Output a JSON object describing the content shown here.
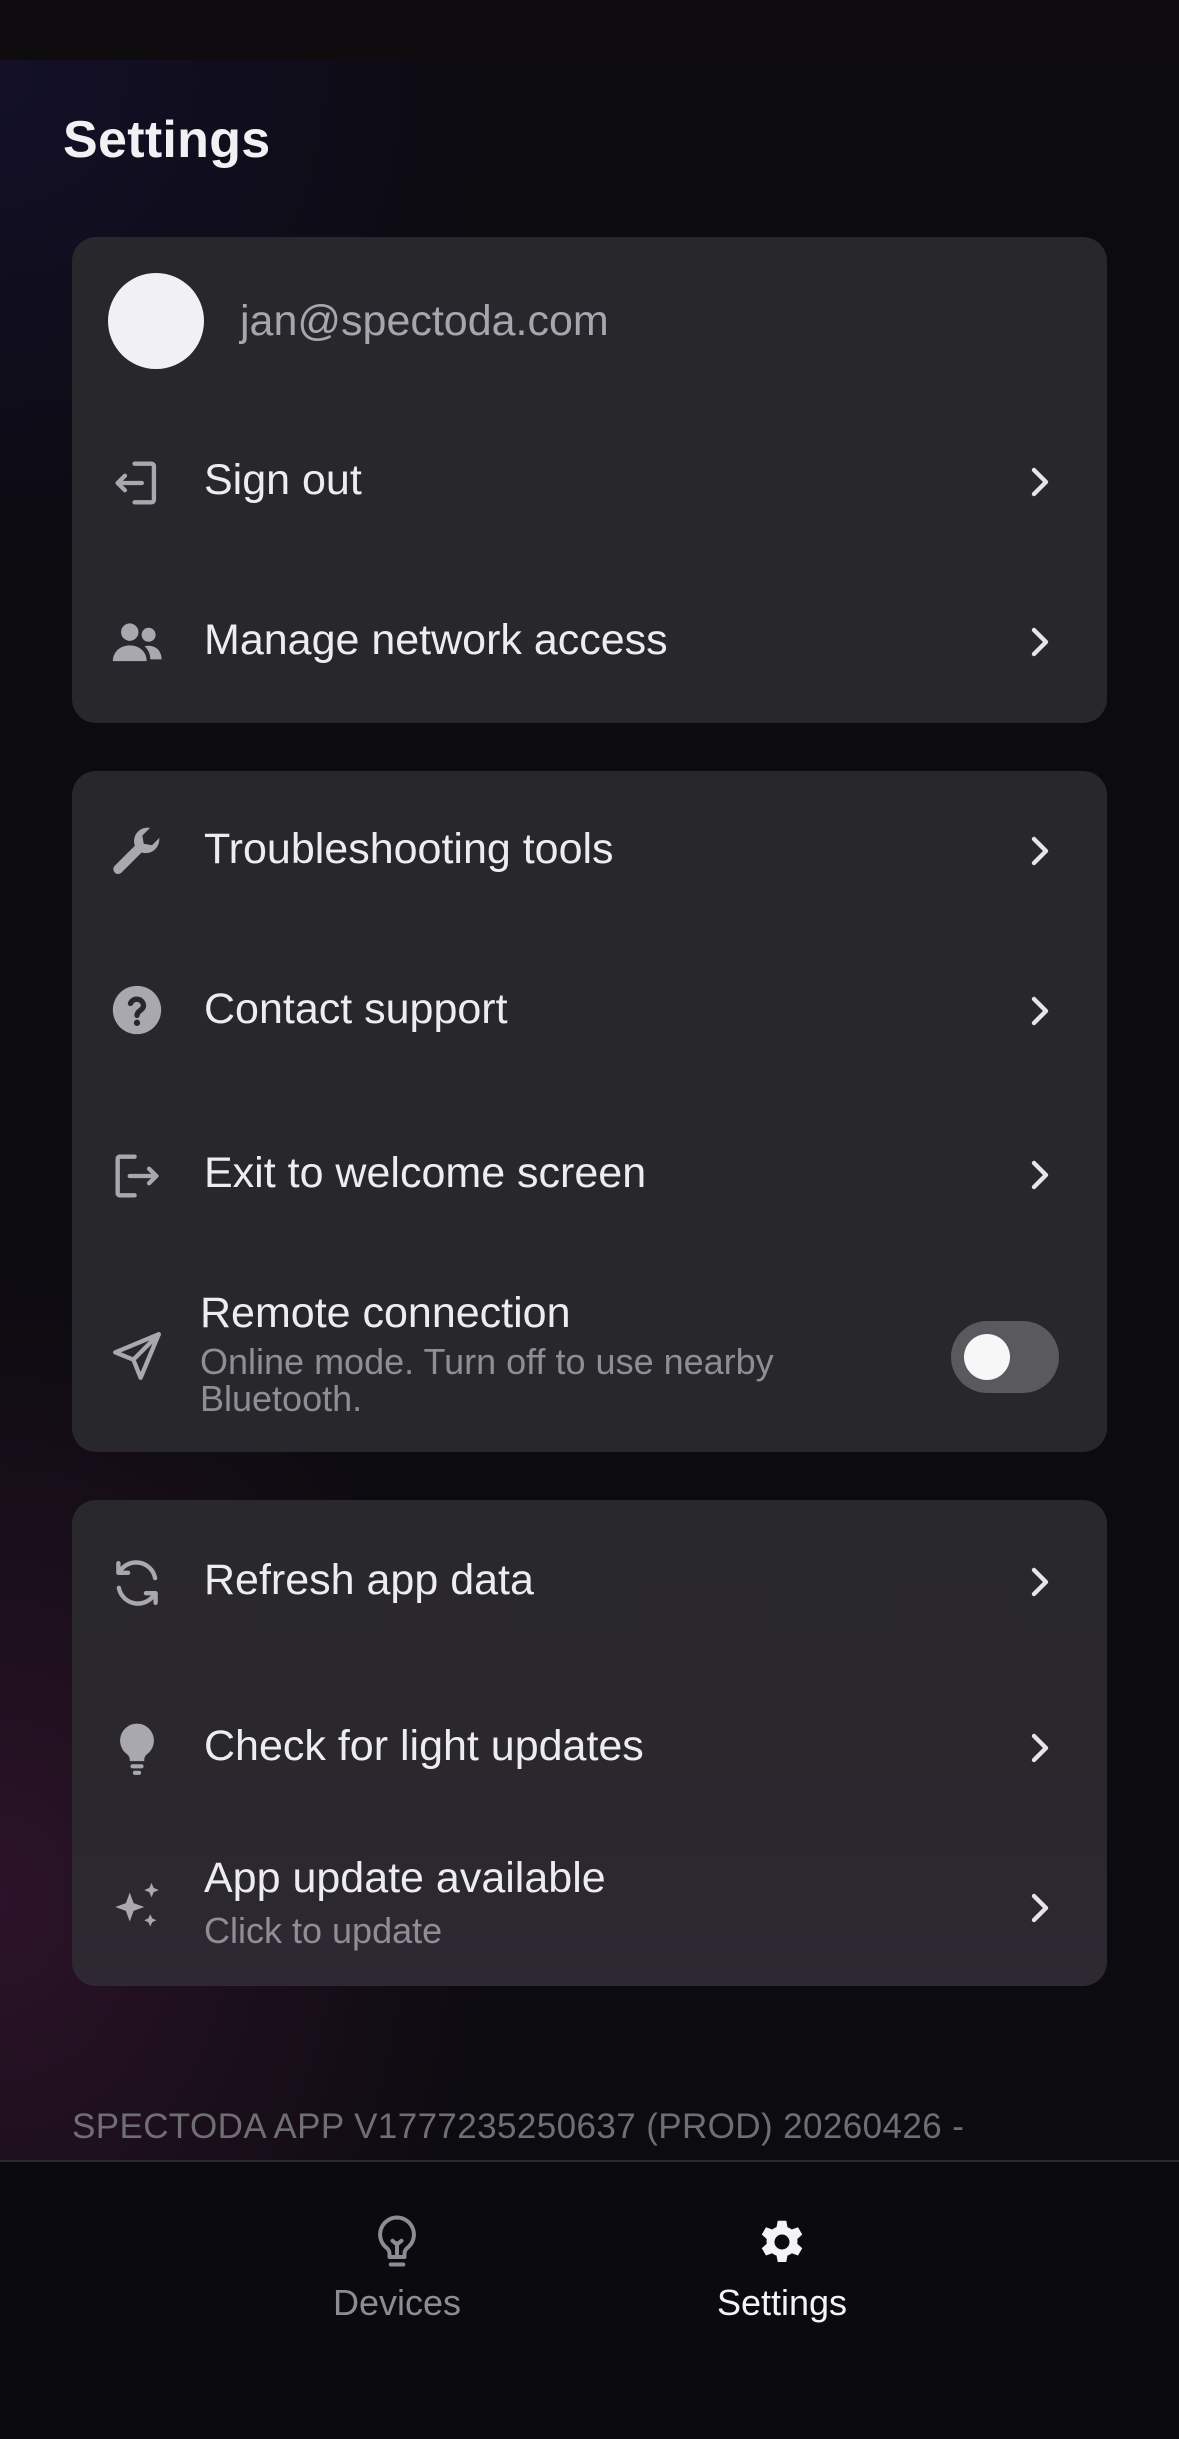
{
  "page": {
    "title": "Settings"
  },
  "account": {
    "email": "jan@spectoda.com",
    "items": [
      {
        "label": "Sign out",
        "icon": "sign-out-icon"
      },
      {
        "label": "Manage network access",
        "icon": "users-icon"
      }
    ]
  },
  "support": {
    "items": [
      {
        "label": "Troubleshooting tools",
        "icon": "wrench-icon"
      },
      {
        "label": "Contact support",
        "icon": "question-circle-icon"
      },
      {
        "label": "Exit to welcome screen",
        "icon": "exit-icon"
      }
    ],
    "remote": {
      "label": "Remote connection",
      "description": "Online mode. Turn off to use nearby Bluetooth.",
      "icon": "paper-plane-icon",
      "enabled": false
    }
  },
  "updates": {
    "items": [
      {
        "label": "Refresh app data",
        "icon": "refresh-icon"
      },
      {
        "label": "Check for light updates",
        "icon": "bulb-icon"
      },
      {
        "label": "App update available",
        "sublabel": "Click to update",
        "icon": "sparkles-icon"
      }
    ]
  },
  "footer": {
    "version": "SPECTODA APP V1777235250637 (PROD) 20260426 -"
  },
  "tabs": [
    {
      "label": "Devices",
      "icon": "bulb-outline-icon",
      "active": false
    },
    {
      "label": "Settings",
      "icon": "gear-icon",
      "active": true
    }
  ],
  "colors": {
    "card": "#28272b",
    "background": "#0c0b10",
    "text": "#ededf0",
    "muted": "#8f8e94",
    "icon": "#a9a8ae",
    "toggle_off": "#5a595e"
  }
}
